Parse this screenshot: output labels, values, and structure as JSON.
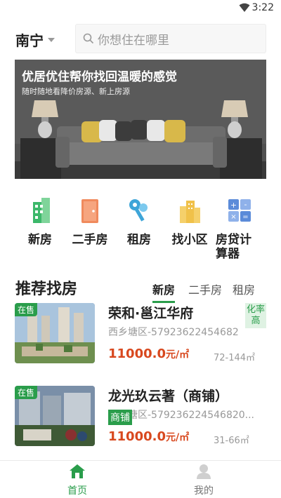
{
  "status_bar": {
    "time": "3:22"
  },
  "header": {
    "city": "南宁",
    "search_placeholder": "你想住在哪里"
  },
  "banner": {
    "title": "优居优住帮你找回温暖的感觉",
    "subtitle": "随时随地看降价房源、新上房源"
  },
  "menu": [
    {
      "label": "新房",
      "icon": "new-house-icon"
    },
    {
      "label": "二手房",
      "icon": "second-hand-house-icon"
    },
    {
      "label": "租房",
      "icon": "rent-key-icon"
    },
    {
      "label": "找小区",
      "icon": "community-icon"
    },
    {
      "label": "房贷计算器",
      "icon": "calculator-icon"
    }
  ],
  "recommend": {
    "title": "推荐找房",
    "tabs": [
      {
        "label": "新房",
        "active": true
      },
      {
        "label": "二手房",
        "active": false
      },
      {
        "label": "租房",
        "active": false
      }
    ]
  },
  "listings": [
    {
      "badge": "在售",
      "name": "荣和·邕江华府",
      "address": "西乡塘区-57923622454682",
      "tag": "化率高",
      "price": "11000.0",
      "unit": "元/㎡",
      "area": "72-144㎡"
    },
    {
      "badge": "在售",
      "name": "龙光玖云著（商铺）",
      "address": "西乡塘区-579236224546820...",
      "tag": "商铺",
      "price": "11000.0",
      "unit": "元/㎡",
      "area": "31-66㎡"
    }
  ],
  "tabbar": [
    {
      "label": "首页",
      "icon": "home-icon",
      "active": true
    },
    {
      "label": "我的",
      "icon": "user-icon",
      "active": false
    }
  ],
  "colors": {
    "accent": "#2a9d4b",
    "price": "#d8481e"
  }
}
